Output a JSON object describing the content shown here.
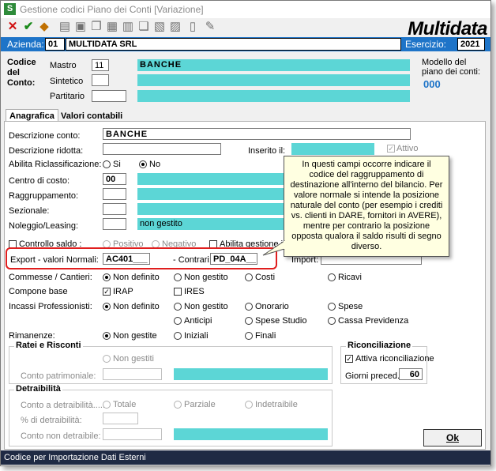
{
  "window": {
    "title": "Gestione codici Piano dei Conti [Variazione]",
    "app_icon_letter": "S",
    "logo": "Multidata"
  },
  "toolbar": {
    "icons": [
      "cancel-icon",
      "save-icon",
      "home-icon",
      "print-icon",
      "document-icon",
      "copy-icon",
      "paste-icon",
      "pages-icon",
      "pen-icon"
    ]
  },
  "azienda_bar": {
    "azienda_label": "Azienda:",
    "azienda_code": "01",
    "azienda_name": "MULTIDATA SRL",
    "esercizio_label": "Esercizio:",
    "esercizio_value": "2021"
  },
  "header": {
    "codice_label_1": "Codice",
    "codice_label_2": "del",
    "codice_label_3": "Conto:",
    "mastro_label": "Mastro",
    "mastro_value": "11",
    "mastro_desc": "BANCHE",
    "sintetico_label": "Sintetico",
    "sintetico_value": "",
    "partitario_label": "Partitario",
    "partitario_value": "",
    "modello_label_1": "Modello del",
    "modello_label_2": "piano dei conti:",
    "modello_value": "000"
  },
  "tabs": [
    {
      "label": "Anagrafica",
      "active": true
    },
    {
      "label": "Valori contabili",
      "active": false
    }
  ],
  "form": {
    "descrizione_conto_label": "Descrizione conto:",
    "descrizione_conto_value": "BANCHE",
    "descrizione_ridotta_label": "Descrizione ridotta:",
    "descrizione_ridotta_value": "",
    "inserito_il_label": "Inserito il:",
    "attivo_label": "Attivo",
    "abilita_riclass_label": "Abilita Riclassificazione:",
    "si_label": "Si",
    "no_label": "No",
    "centro_di_costo_label": "Centro di costo:",
    "centro_di_costo_value": "00",
    "raggruppamento_label": "Raggruppamento:",
    "sezionale_label": "Sezionale:",
    "noleggio_label": "Noleggio/Leasing:",
    "noleggio_value": "non gestito",
    "controllo_saldo_label": "Controllo saldo :",
    "positivo_label": "Positivo",
    "negativo_label": "Negativo",
    "abilita_gestione_label": "Abilita gestione in V",
    "export_label": "Export - valori Normali:",
    "export_value": "AC401___",
    "contrari_label": "- Contrari:",
    "contrari_value": "PD_04A__",
    "import_label": "Import:",
    "commesse_label": "Commesse / Cantieri:",
    "commesse_options": [
      "Non definito",
      "Non gestito",
      "Costi",
      "Ricavi"
    ],
    "compone_base_label": "Compone base",
    "irap_label": "IRAP",
    "ires_label": "IRES",
    "incassi_label": "Incassi Professionisti:",
    "incassi_options": [
      "Non definito",
      "Non gestito",
      "Onorario",
      "Spese",
      "Anticipi",
      "Spese Studio",
      "Cassa Previdenza"
    ],
    "rimanenze_label": "Rimanenze:",
    "rimanenze_options": [
      "Non gestite",
      "Iniziali",
      "Finali"
    ]
  },
  "ratei": {
    "title": "Ratei e Risconti",
    "non_gestiti_label": "Non gestiti",
    "conto_patrimoniale_label": "Conto patrimoniale:"
  },
  "riconciliazione": {
    "title": "Riconciliazione",
    "attiva_label": "Attiva riconciliazione",
    "giorni_label": "Giorni preced.:",
    "giorni_value": "60"
  },
  "detraibilita": {
    "title": "Detraibilità",
    "conto_a_detraibilita_label": "Conto a detraibilità.....",
    "totale_label": "Totale",
    "parziale_label": "Parziale",
    "indetraibile_label": "Indetraibile",
    "perc_label": "% di detraibilità:",
    "conto_non_detraibile_label": "Conto non detraibile:"
  },
  "tooltip": {
    "text": "In questi campi occorre indicare il codice del raggruppamento di destinazione all'interno del bilancio. Per valore normale si intende la posizione naturale del conto (per esempio i crediti vs. clienti in DARE, fornitori in AVERE), mentre per contrario la posizione opposta qualora il saldo risulti di segno diverso."
  },
  "ok_button": {
    "label": "Ok"
  },
  "status_bar": {
    "text": "Codice per Importazione Dati Esterni"
  },
  "colors": {
    "accent_blue": "#1e74c8",
    "field_cyan": "#5cd6d6",
    "highlight_red": "#e01e1e",
    "tooltip_bg": "#ffffe1",
    "status_bg": "#1f2a44"
  }
}
